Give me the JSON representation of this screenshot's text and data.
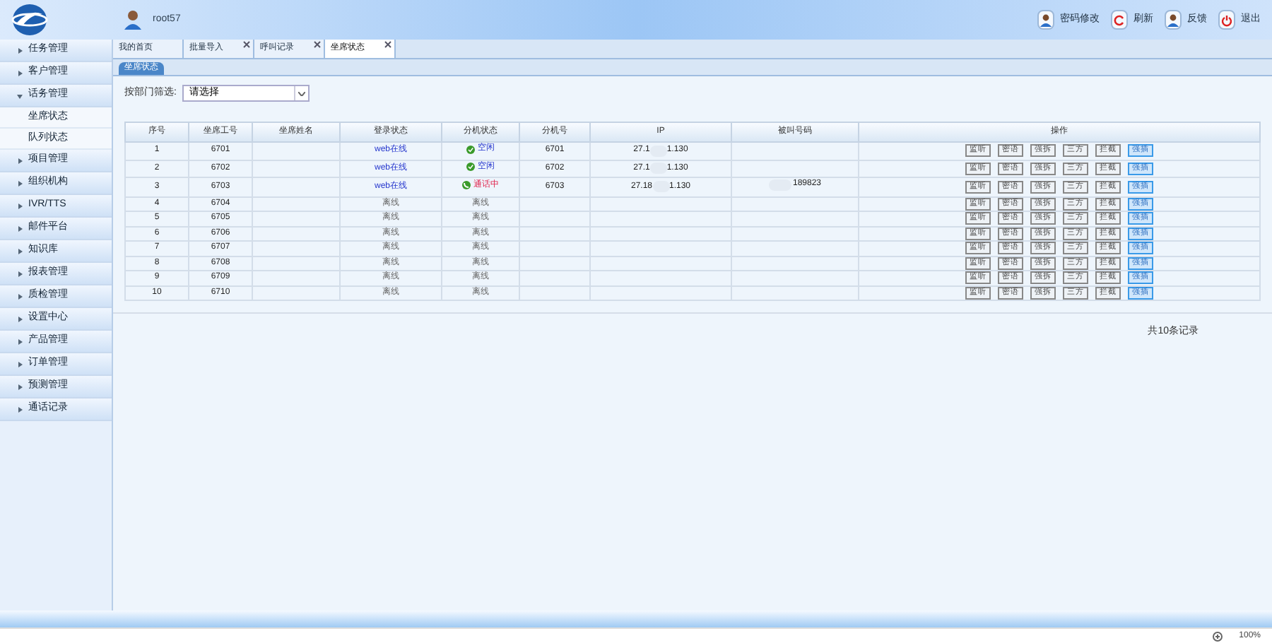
{
  "header": {
    "user": "root57",
    "actions": [
      {
        "label": "密码修改",
        "kind": "user"
      },
      {
        "label": "刷新",
        "kind": "refresh"
      },
      {
        "label": "反馈",
        "kind": "user"
      },
      {
        "label": "退出",
        "kind": "power"
      }
    ]
  },
  "sidebar": {
    "items": [
      {
        "label": "任务管理",
        "expanded": false
      },
      {
        "label": "客户管理",
        "expanded": false
      },
      {
        "label": "话务管理",
        "expanded": true,
        "children": [
          {
            "label": "坐席状态"
          },
          {
            "label": "队列状态"
          }
        ]
      },
      {
        "label": "项目管理",
        "expanded": false
      },
      {
        "label": "组织机构",
        "expanded": false
      },
      {
        "label": "IVR/TTS",
        "expanded": false
      },
      {
        "label": "邮件平台",
        "expanded": false
      },
      {
        "label": "知识库",
        "expanded": false
      },
      {
        "label": "报表管理",
        "expanded": false
      },
      {
        "label": "质检管理",
        "expanded": false
      },
      {
        "label": "设置中心",
        "expanded": false
      },
      {
        "label": "产品管理",
        "expanded": false
      },
      {
        "label": "订单管理",
        "expanded": false
      },
      {
        "label": "预测管理",
        "expanded": false
      },
      {
        "label": "通话记录",
        "expanded": false
      }
    ]
  },
  "tabs": [
    {
      "label": "我的首页",
      "selected": false,
      "closable": false
    },
    {
      "label": "批量导入",
      "selected": false,
      "closable": true
    },
    {
      "label": "呼叫记录",
      "selected": false,
      "closable": true
    },
    {
      "label": "坐席状态",
      "selected": true,
      "closable": true
    }
  ],
  "subtab": "坐席状态",
  "filter": {
    "label": "按部门筛选:",
    "value": "请选择"
  },
  "table": {
    "columns": [
      "序号",
      "坐席工号",
      "坐席姓名",
      "登录状态",
      "分机状态",
      "分机号",
      "IP",
      "被叫号码",
      "操作"
    ],
    "rows": [
      {
        "no": "1",
        "agent": "6701",
        "login": {
          "label": "web在线",
          "kind": "online"
        },
        "ext_status": {
          "label": "空闲",
          "kind": "idle"
        },
        "ext": "6701",
        "ip": [
          "27.1",
          "1.130"
        ],
        "operations": [
          "监听",
          "密语",
          "强拆",
          "三方",
          "拦截",
          "强插"
        ]
      },
      {
        "no": "2",
        "agent": "6702",
        "login": {
          "label": "web在线",
          "kind": "online"
        },
        "ext_status": {
          "label": "空闲",
          "kind": "idle"
        },
        "ext": "6702",
        "ip": [
          "27.1",
          "1.130"
        ],
        "operations": [
          "监听",
          "密语",
          "强拆",
          "三方",
          "拦截",
          "强插"
        ]
      },
      {
        "no": "3",
        "agent": "6703",
        "login": {
          "label": "web在线",
          "kind": "online"
        },
        "ext_status": {
          "label": "通话中",
          "kind": "busy"
        },
        "ext": "6703",
        "ip": [
          "27.18",
          "1.130"
        ],
        "called": "189823",
        "operations": [
          "监听",
          "密语",
          "强拆",
          "三方",
          "拦截",
          "强插"
        ]
      },
      {
        "no": "4",
        "agent": "6704",
        "login": {
          "label": "离线",
          "kind": "offline"
        },
        "ext_status": {
          "label": "离线",
          "kind": "offline"
        },
        "operations": [
          "监听",
          "密语",
          "强拆",
          "三方",
          "拦截",
          "强插"
        ]
      },
      {
        "no": "5",
        "agent": "6705",
        "login": {
          "label": "离线",
          "kind": "offline"
        },
        "ext_status": {
          "label": "离线",
          "kind": "offline"
        },
        "operations": [
          "监听",
          "密语",
          "强拆",
          "三方",
          "拦截",
          "强插"
        ]
      },
      {
        "no": "6",
        "agent": "6706",
        "login": {
          "label": "离线",
          "kind": "offline"
        },
        "ext_status": {
          "label": "离线",
          "kind": "offline"
        },
        "operations": [
          "监听",
          "密语",
          "强拆",
          "三方",
          "拦截",
          "强插"
        ]
      },
      {
        "no": "7",
        "agent": "6707",
        "login": {
          "label": "离线",
          "kind": "offline"
        },
        "ext_status": {
          "label": "离线",
          "kind": "offline"
        },
        "operations": [
          "监听",
          "密语",
          "强拆",
          "三方",
          "拦截",
          "强插"
        ]
      },
      {
        "no": "8",
        "agent": "6708",
        "login": {
          "label": "离线",
          "kind": "offline"
        },
        "ext_status": {
          "label": "离线",
          "kind": "offline"
        },
        "operations": [
          "监听",
          "密语",
          "强拆",
          "三方",
          "拦截",
          "强插"
        ]
      },
      {
        "no": "9",
        "agent": "6709",
        "login": {
          "label": "离线",
          "kind": "offline"
        },
        "ext_status": {
          "label": "离线",
          "kind": "offline"
        },
        "operations": [
          "监听",
          "密语",
          "强拆",
          "三方",
          "拦截",
          "强插"
        ]
      },
      {
        "no": "10",
        "agent": "6710",
        "login": {
          "label": "离线",
          "kind": "offline"
        },
        "ext_status": {
          "label": "离线",
          "kind": "offline"
        },
        "operations": [
          "监听",
          "密语",
          "强拆",
          "三方",
          "拦截",
          "强插"
        ]
      }
    ]
  },
  "total": "共10条记录",
  "status_bar": {
    "zoom": "100%"
  }
}
